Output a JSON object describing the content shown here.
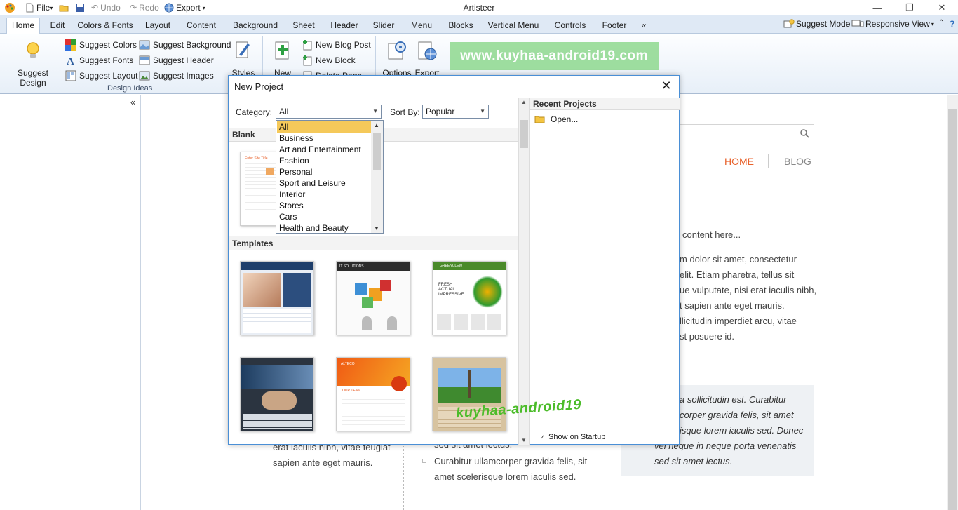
{
  "titlebar": {
    "file": "File",
    "undo": "Undo",
    "redo": "Redo",
    "export": "Export",
    "title": "Artisteer",
    "minimize": "—",
    "restore": "❐",
    "close": "✕"
  },
  "tabs": [
    "Home",
    "Edit",
    "Colors & Fonts",
    "Layout",
    "Content",
    "Background",
    "Sheet",
    "Header",
    "Slider",
    "Menu",
    "Blocks",
    "Vertical Menu",
    "Controls",
    "Footer",
    "«"
  ],
  "tabs_right": {
    "suggest_mode": "Suggest Mode",
    "responsive_view": "Responsive View",
    "collapse": "⌃",
    "help": "?"
  },
  "ribbon": {
    "suggest_design": "Suggest Design",
    "suggest_colors": "Suggest Colors",
    "suggest_fonts": "Suggest Fonts",
    "suggest_layout": "Suggest Layout",
    "suggest_background": "Suggest Background",
    "suggest_header": "Suggest Header",
    "suggest_images": "Suggest Images",
    "styles": "Styles",
    "design_ideas": "Design Ideas",
    "new": "New",
    "new_blog_post": "New Blog Post",
    "new_block": "New Block",
    "delete_page": "Delete Page",
    "options": "Options",
    "export": "Export",
    "watermark": "www.kuyhaa-android19.com"
  },
  "left_panel": {
    "collapse": "«"
  },
  "workspace": {
    "nav": {
      "home": "HOME",
      "blog": "BLOG"
    },
    "lines": [
      "content here...",
      "m dolor sit amet, consectetur",
      "elit. Etiam pharetra, tellus sit",
      "ue vulputate, nisi erat iaculis nibh,",
      "t sapien ante eget mauris.",
      "llicitudin imperdiet arcu, vitae",
      "st posuere id."
    ],
    "quote_lines": [
      "a sollicitudin est. Curabitur",
      "corper gravida felis, sit amet",
      "isque lorem iaculis sed. Donec",
      "vel neque in neque porta venenatis",
      "sed sit amet lectus."
    ],
    "col1_lines": [
      "erat iaculis nibh, vitae feugiat",
      "sapien ante eget mauris."
    ],
    "col2_lines": [
      "sed sit amet lectus.",
      "Curabitur ullamcorper gravida felis, sit",
      "amet scelerisque lorem iaculis sed."
    ]
  },
  "dialog": {
    "title": "New Project",
    "close": "✕",
    "category_label": "Category:",
    "category_value": "All",
    "sort_label": "Sort By:",
    "sort_value": "Popular",
    "blank_header": "Blank",
    "templates_header": "Templates",
    "recent_header": "Recent Projects",
    "open": "Open...",
    "show_on_startup": "Show on Startup",
    "categories": [
      "All",
      "Business",
      "Art and Entertainment",
      "Fashion",
      "Personal",
      "Sport and Leisure",
      "Interior",
      "Stores",
      "Cars",
      "Health and Beauty"
    ],
    "template_texts": {
      "t2_tag": "IT SOLUTIONS",
      "t3_tag": "GREENCLEW",
      "t3_lines": [
        "FRESH",
        "ACTUAL",
        "IMPRESSIVE"
      ],
      "t5_tag": "ALTECO",
      "t5_team": "OUR TEAM",
      "blank_title": "Enter Site Title"
    },
    "logo": "kuyhaa-android19"
  },
  "colors": {
    "accent": "#e8622c",
    "selection": "#f5c95a",
    "ribbon_bg": "#dfe9f5",
    "dialog_border": "#4a8fd6"
  }
}
